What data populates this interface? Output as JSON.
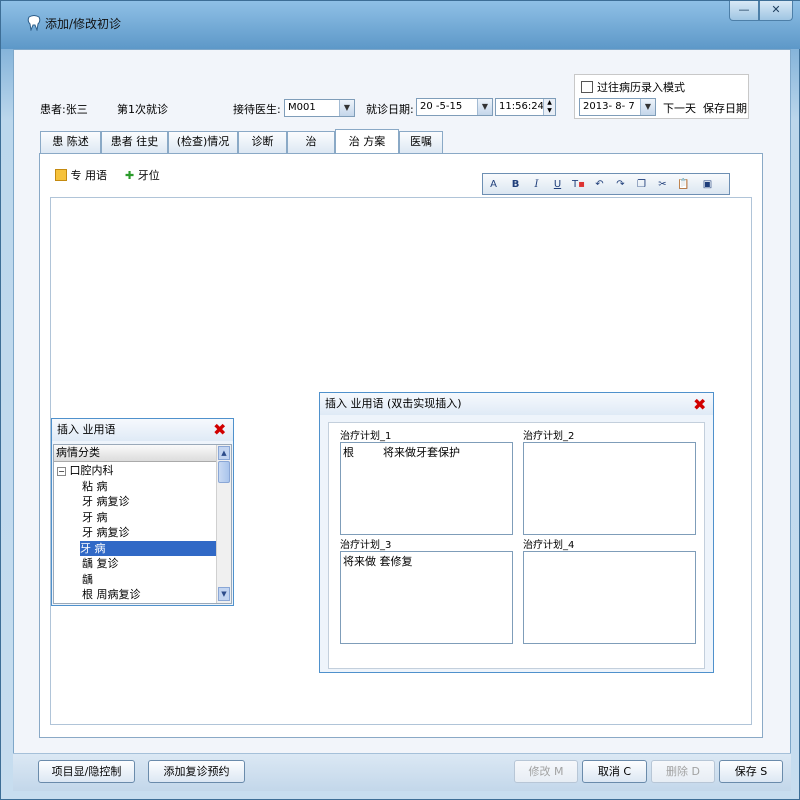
{
  "window": {
    "title": "添加/修改初诊",
    "minimize_label": "—",
    "close_label": "✕"
  },
  "header": {
    "patient_label": "患者:张三",
    "visit_label": "第1次就诊",
    "doctor_label": "接待医生:",
    "doctor_value": "M001",
    "date_label": "就诊日期:",
    "date_value": "20  -5-15",
    "time_value": "11:56:24",
    "history_mode_label": "过往病历录入模式",
    "history_date_value": "2013- 8- 7",
    "next_day_label": "下一天",
    "save_date_label": "保存日期"
  },
  "tabs": [
    "患 陈述",
    "患者 往史",
    "(检查)情况",
    "诊断",
    "治 ",
    "治 方案",
    "医嘱"
  ],
  "active_tab_index": 5,
  "actions": {
    "term_label": "专 用语",
    "tooth_label": "牙位"
  },
  "term_popup": {
    "title": "插入 业用语",
    "column_header": "病情分类",
    "root": "口腔内科",
    "items": [
      "粘 病",
      "牙 病复诊",
      "牙 病",
      "牙 病复诊",
      "牙 病",
      "龋 复诊",
      "龋 ",
      "根 周病复诊"
    ],
    "selected_index": 4
  },
  "plan_popup": {
    "title": "插入 业用语 (双击实现插入)",
    "plans": [
      {
        "label": "治疗计划_1",
        "text": "根 　　 将来做牙套保护"
      },
      {
        "label": "治疗计划_2",
        "text": ""
      },
      {
        "label": "治疗计划_3",
        "text": "将来做 套修复"
      },
      {
        "label": "治疗计划_4",
        "text": ""
      }
    ]
  },
  "footer": {
    "toggle_label": "项目显/隐控制",
    "followup_label": "添加复诊预约",
    "modify_label": "修改 M",
    "cancel_label": "取消 C",
    "delete_label": "删除 D",
    "save_label": "保存 S"
  },
  "toolbar_icons": [
    "font-icon",
    "bold-icon",
    "italic-icon",
    "underline-icon",
    "text-color-icon",
    "undo-icon",
    "redo-icon",
    "copy-icon",
    "cut-icon",
    "paste-icon",
    "image-icon"
  ],
  "colors": {
    "selection": "#3169c6",
    "close_red": "#d10000",
    "accent": "#4f91cc"
  }
}
